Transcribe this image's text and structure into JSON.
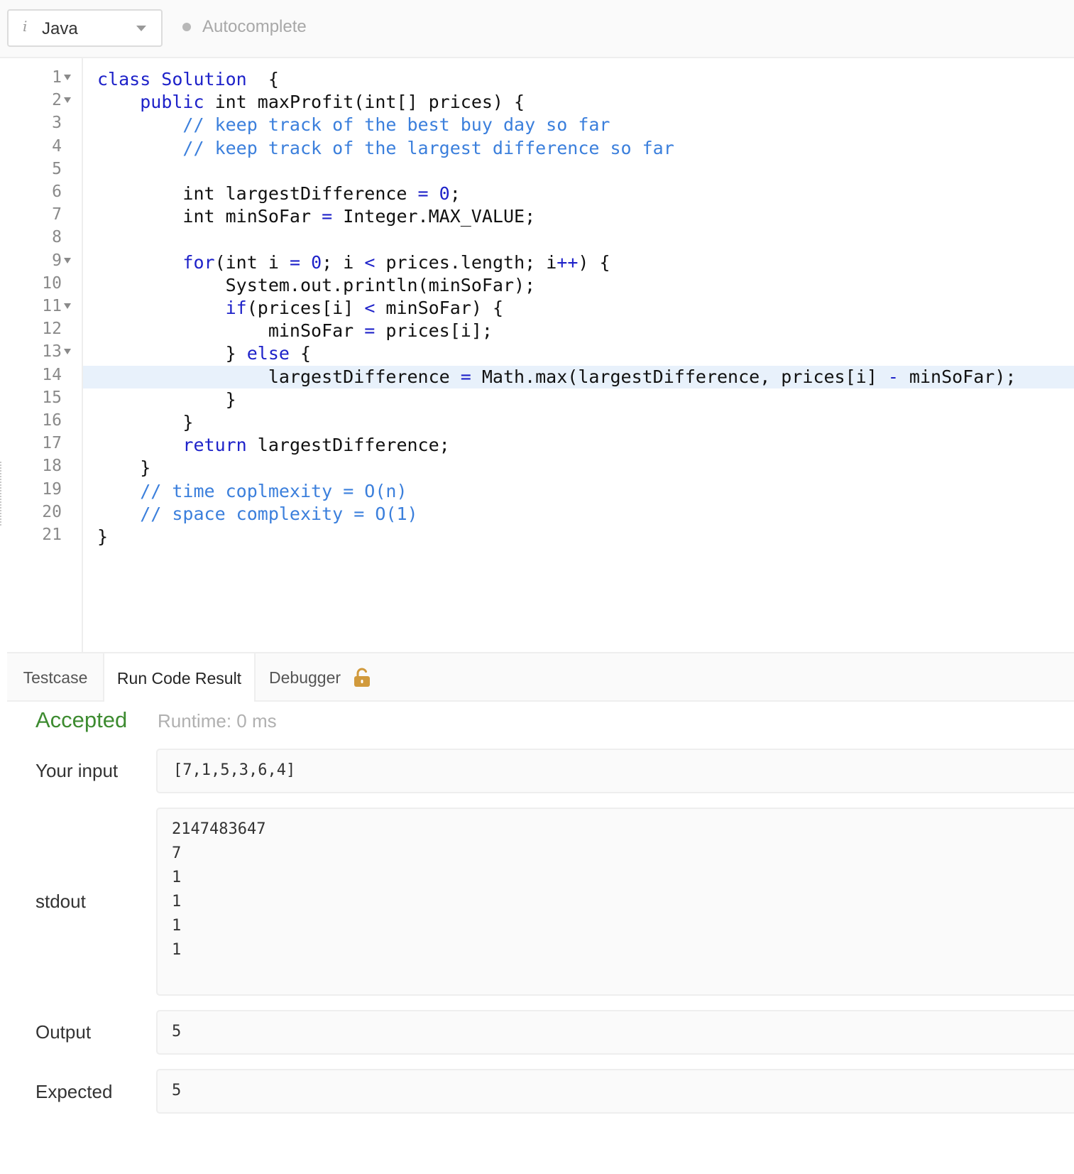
{
  "toolbar": {
    "language": "Java",
    "language_icon": "i",
    "autocomplete_label": "Autocomplete"
  },
  "editor": {
    "lines": [
      {
        "num": "1",
        "fold": true
      },
      {
        "num": "2",
        "fold": true
      },
      {
        "num": "3",
        "fold": false
      },
      {
        "num": "4",
        "fold": false
      },
      {
        "num": "5",
        "fold": false
      },
      {
        "num": "6",
        "fold": false
      },
      {
        "num": "7",
        "fold": false
      },
      {
        "num": "8",
        "fold": false
      },
      {
        "num": "9",
        "fold": true
      },
      {
        "num": "10",
        "fold": false
      },
      {
        "num": "11",
        "fold": true
      },
      {
        "num": "12",
        "fold": false
      },
      {
        "num": "13",
        "fold": true
      },
      {
        "num": "14",
        "fold": false
      },
      {
        "num": "15",
        "fold": false
      },
      {
        "num": "16",
        "fold": false
      },
      {
        "num": "17",
        "fold": false
      },
      {
        "num": "18",
        "fold": false
      },
      {
        "num": "19",
        "fold": false
      },
      {
        "num": "20",
        "fold": false
      },
      {
        "num": "21",
        "fold": false
      }
    ],
    "active_line": 14,
    "code": [
      [
        [
          "kw",
          "class Solution"
        ],
        [
          "",
          "  {"
        ]
      ],
      [
        [
          "",
          "    "
        ],
        [
          "kw",
          "public"
        ],
        [
          "",
          " int maxProfit(int[] prices) {"
        ]
      ],
      [
        [
          "",
          "        "
        ],
        [
          "cm",
          "// keep track of the best buy day so far"
        ]
      ],
      [
        [
          "",
          "        "
        ],
        [
          "cm",
          "// keep track of the largest difference so far"
        ]
      ],
      [
        [
          "",
          ""
        ]
      ],
      [
        [
          "",
          "        int largestDifference "
        ],
        [
          "op",
          "="
        ],
        [
          "",
          " "
        ],
        [
          "op",
          "0"
        ],
        [
          "",
          ";"
        ]
      ],
      [
        [
          "",
          "        int minSoFar "
        ],
        [
          "op",
          "="
        ],
        [
          "",
          " Integer.MAX_VALUE;"
        ]
      ],
      [
        [
          "",
          ""
        ]
      ],
      [
        [
          "",
          "        "
        ],
        [
          "kw",
          "for"
        ],
        [
          "",
          "(int i "
        ],
        [
          "op",
          "="
        ],
        [
          "",
          " "
        ],
        [
          "op",
          "0"
        ],
        [
          "",
          "; i "
        ],
        [
          "op",
          "<"
        ],
        [
          "",
          " prices.length; i"
        ],
        [
          "op",
          "++"
        ],
        [
          "",
          ") {"
        ]
      ],
      [
        [
          "",
          "            System.out.println(minSoFar);"
        ]
      ],
      [
        [
          "",
          "            "
        ],
        [
          "kw",
          "if"
        ],
        [
          "",
          "(prices[i] "
        ],
        [
          "op",
          "<"
        ],
        [
          "",
          " minSoFar) {"
        ]
      ],
      [
        [
          "",
          "                minSoFar "
        ],
        [
          "op",
          "="
        ],
        [
          "",
          " prices[i];"
        ]
      ],
      [
        [
          "",
          "            } "
        ],
        [
          "kw",
          "else"
        ],
        [
          "",
          " {"
        ]
      ],
      [
        [
          "",
          "                largestDifference "
        ],
        [
          "op",
          "="
        ],
        [
          "",
          " Math.max(largestDifference, prices[i] "
        ],
        [
          "op",
          "-"
        ],
        [
          "",
          " minSoFar);"
        ]
      ],
      [
        [
          "",
          "            }"
        ]
      ],
      [
        [
          "",
          "        }"
        ]
      ],
      [
        [
          "",
          "        "
        ],
        [
          "kw",
          "return"
        ],
        [
          "",
          " largestDifference;"
        ]
      ],
      [
        [
          "",
          "    }"
        ]
      ],
      [
        [
          "",
          "    "
        ],
        [
          "cm",
          "// time coplmexity = O(n)"
        ]
      ],
      [
        [
          "",
          "    "
        ],
        [
          "cm",
          "// space complexity = O(1)"
        ]
      ],
      [
        [
          "",
          "}"
        ]
      ]
    ]
  },
  "tabs": [
    {
      "label": "Testcase"
    },
    {
      "label": "Run Code Result"
    },
    {
      "label": "Debugger"
    }
  ],
  "result": {
    "status": "Accepted",
    "runtime": "Runtime: 0 ms",
    "input_label": "Your input",
    "input_value": "[7,1,5,3,6,4]",
    "stdout_label": "stdout",
    "stdout_lines": [
      "2147483647",
      "7",
      "1",
      "1",
      "1",
      "1"
    ],
    "output_label": "Output",
    "output_value": "5",
    "expected_label": "Expected",
    "expected_value": "5"
  },
  "colors": {
    "keyword": "#1e22c9",
    "comment": "#3b7fdc",
    "accepted": "#3d8b30",
    "active_line": "#e8f1fb",
    "lock": "#d19a3c"
  }
}
